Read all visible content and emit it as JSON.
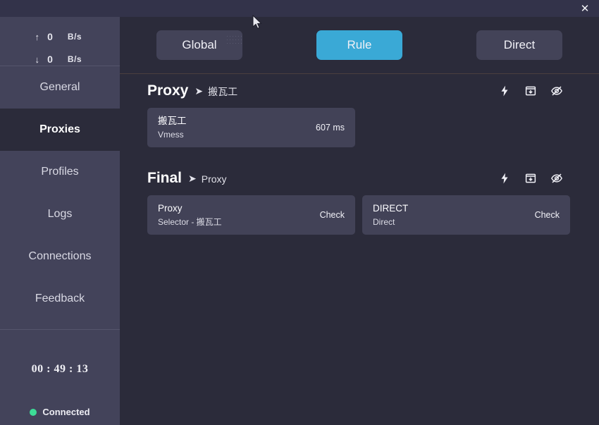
{
  "window": {
    "close_label": "✕",
    "close_icon": "close-icon"
  },
  "colors": {
    "titlebar": "#33334a",
    "sidebar": "#43435a",
    "content": "#2b2b3a",
    "card": "#424257",
    "accent": "#3aa9d6",
    "connected": "#3ddc97"
  },
  "sidebar": {
    "speed": {
      "upload": {
        "arrow": "↑",
        "value": "0",
        "unit": "B/s"
      },
      "download": {
        "arrow": "↓",
        "value": "0",
        "unit": "B/s"
      }
    },
    "items": [
      {
        "label": "General",
        "active": false
      },
      {
        "label": "Proxies",
        "active": true
      },
      {
        "label": "Profiles",
        "active": false
      },
      {
        "label": "Logs",
        "active": false
      },
      {
        "label": "Connections",
        "active": false
      },
      {
        "label": "Feedback",
        "active": false
      }
    ],
    "status": {
      "timer": "00 : 49 : 13",
      "connection": "Connected"
    }
  },
  "modes": {
    "global": "Global",
    "rule": "Rule",
    "direct": "Direct",
    "selected": "Rule"
  },
  "groups": [
    {
      "name": "Proxy",
      "arrow": "➤",
      "selected": "搬瓦工",
      "icons": [
        "lightning-icon",
        "collapse-icon",
        "eye-off-icon"
      ],
      "cards": [
        {
          "title": "搬瓦工",
          "subtitle": "Vmess",
          "right": "607 ms"
        }
      ]
    },
    {
      "name": "Final",
      "arrow": "➤",
      "selected": "Proxy",
      "icons": [
        "lightning-icon",
        "collapse-icon",
        "eye-off-icon"
      ],
      "cards": [
        {
          "title": "Proxy",
          "subtitle": "Selector - 搬瓦工",
          "right": "Check"
        },
        {
          "title": "DIRECT",
          "subtitle": "Direct",
          "right": "Check"
        }
      ]
    }
  ]
}
